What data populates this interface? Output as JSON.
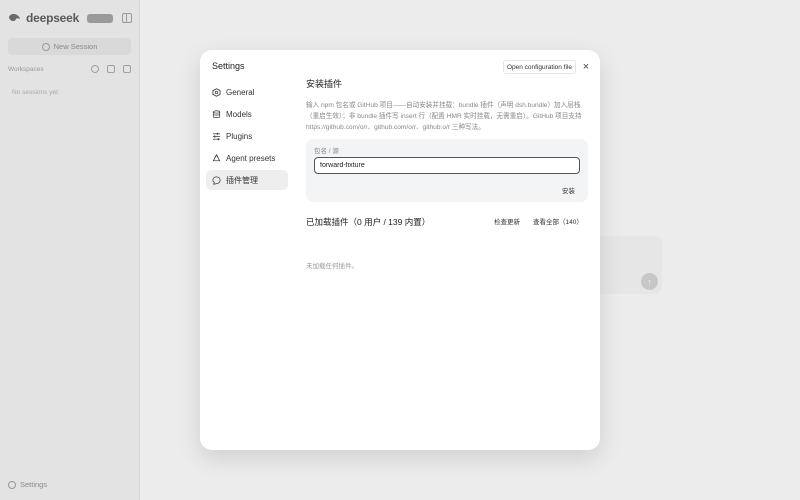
{
  "app": {
    "brand": "deepseek",
    "badge": "",
    "new_session": "New Session",
    "workspaces_label": "Workspaces",
    "no_sessions": "No sessions yet",
    "settings_link": "Settings",
    "accent": "#222222",
    "background": "#ececec"
  },
  "modal": {
    "title": "Settings",
    "open_config": "Open configuration file",
    "close": "×",
    "nav": [
      {
        "label": "General",
        "icon": "shield-icon",
        "active": false
      },
      {
        "label": "Models",
        "icon": "database-icon",
        "active": false
      },
      {
        "label": "Plugins",
        "icon": "sliders-icon",
        "active": false
      },
      {
        "label": "Agent presets",
        "icon": "recycle-icon",
        "active": false
      },
      {
        "label": "插件管理",
        "icon": "chat-bubble-icon",
        "active": true
      }
    ]
  },
  "plugins": {
    "install_title": "安装插件",
    "description": "输入 npm 包名或 GitHub 项目——自动安装并挂载：bundle 插件（声明 dsh.bundle）加入层栈（重启生效）；非 bundle 插件写 insert 行（配置 HMR 实时挂载，无需重启）。GitHub 项目支持 https://github.com/o/r、github.com/o/r、github:o/r 三种写法。",
    "field_label": "包名 / 源",
    "input_value": "forward-fixture",
    "install_button": "安装",
    "loaded_title": "已加载插件（0 用户 / 139 内置）",
    "check_updates": "检查更新",
    "view_all": "查看全部（140）",
    "empty": "未加载任何插件。"
  }
}
